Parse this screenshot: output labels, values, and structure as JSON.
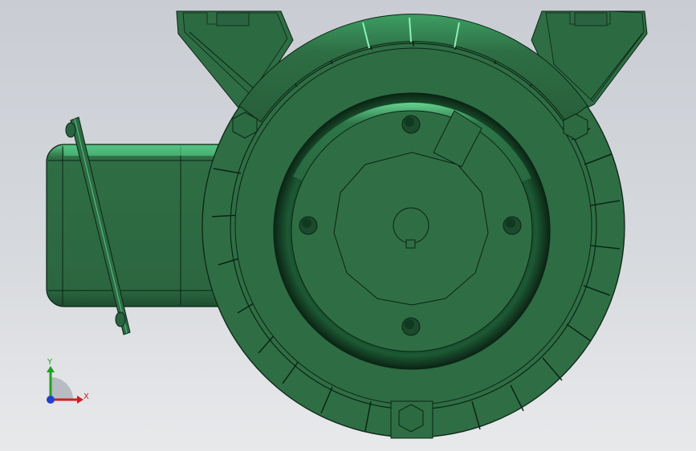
{
  "view": {
    "model_color": "#2f6e45",
    "edge_color": "#0b2414",
    "highlight_color": "#45c978",
    "background_top": "#c9cdd3",
    "background_bottom": "#e8e9eb"
  },
  "triad": {
    "x_label": "X",
    "y_label": "Y",
    "x_color": "#d02020",
    "y_color": "#20a020",
    "z_color": "#2040d0"
  }
}
